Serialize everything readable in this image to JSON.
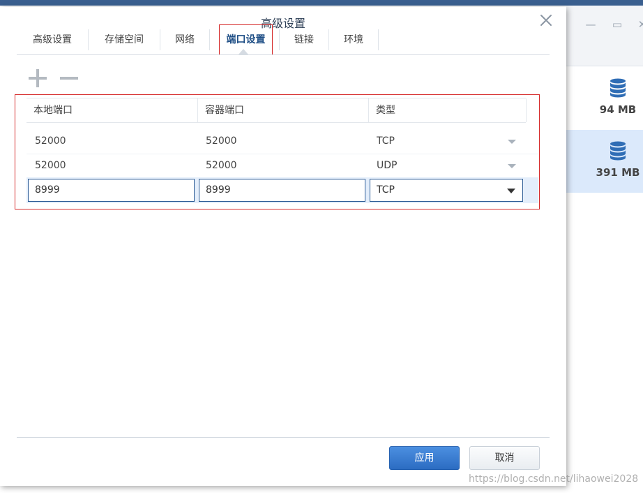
{
  "dialog": {
    "title": "高级设置",
    "tabs": [
      {
        "label": "高级设置"
      },
      {
        "label": "存储空间"
      },
      {
        "label": "网络"
      },
      {
        "label": "端口设置"
      },
      {
        "label": "链接"
      },
      {
        "label": "环境"
      }
    ],
    "active_tab": "端口设置"
  },
  "toolbar": {
    "add_icon": "plus-icon",
    "remove_icon": "minus-icon"
  },
  "port_table": {
    "columns": [
      "本地端口",
      "容器端口",
      "类型"
    ],
    "rows": [
      {
        "local": "52000",
        "container": "52000",
        "type": "TCP"
      },
      {
        "local": "52000",
        "container": "52000",
        "type": "UDP"
      }
    ],
    "edit_row": {
      "local": "8999",
      "container": "8999",
      "type": "TCP"
    }
  },
  "footer": {
    "apply_label": "应用",
    "cancel_label": "取消"
  },
  "background_window": {
    "items": [
      {
        "size": "94 MB"
      },
      {
        "size": "391 MB"
      }
    ]
  },
  "watermark": "https://blog.csdn.net/lihaowei2028",
  "colors": {
    "accent": "#2c6cc2",
    "highlight_outline": "#d62d2d",
    "selected_bg": "#dbe9fb"
  }
}
